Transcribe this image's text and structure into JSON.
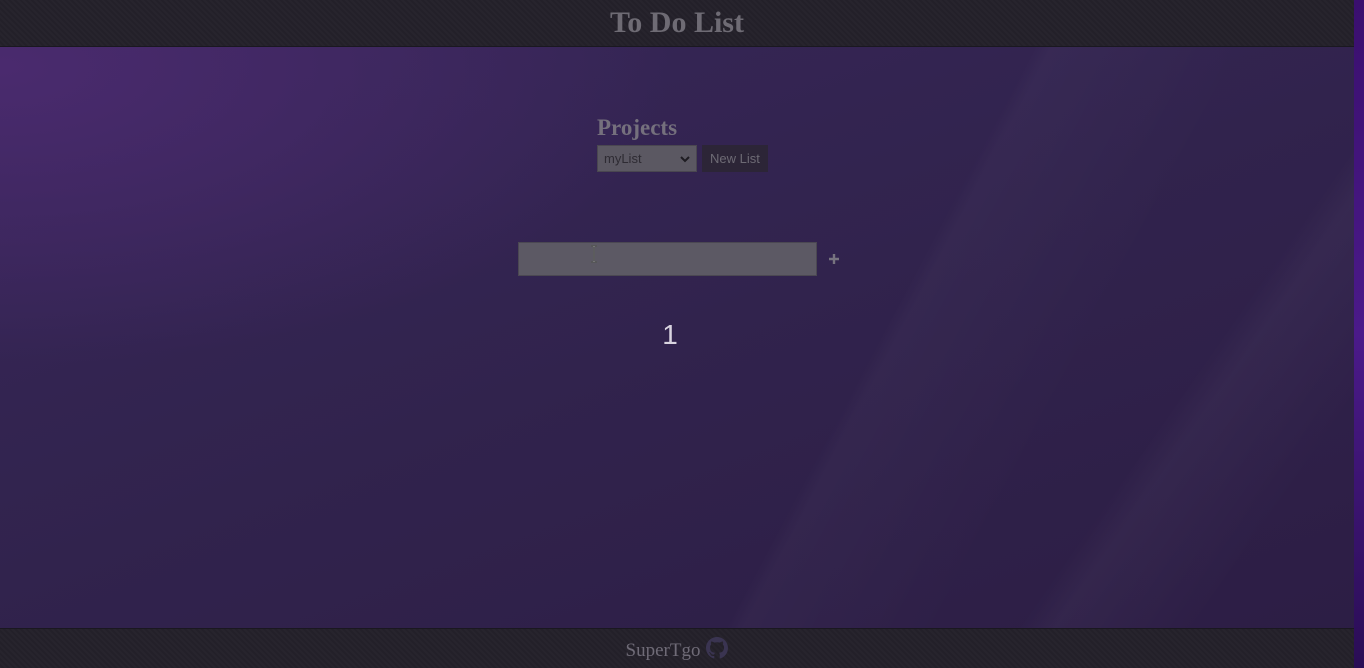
{
  "header": {
    "title": "To Do List"
  },
  "projects": {
    "heading": "Projects",
    "selected": "myList",
    "new_list_label": "New List"
  },
  "task_entry": {
    "value": "",
    "add_symbol": "+"
  },
  "task_count": "1",
  "footer": {
    "author": "SuperTgo",
    "link_icon": "github-icon"
  },
  "colors": {
    "background": "#33244f",
    "bar": "#232029",
    "text_muted": "#6e6b74",
    "accent_strip": "#4b1a8a"
  }
}
